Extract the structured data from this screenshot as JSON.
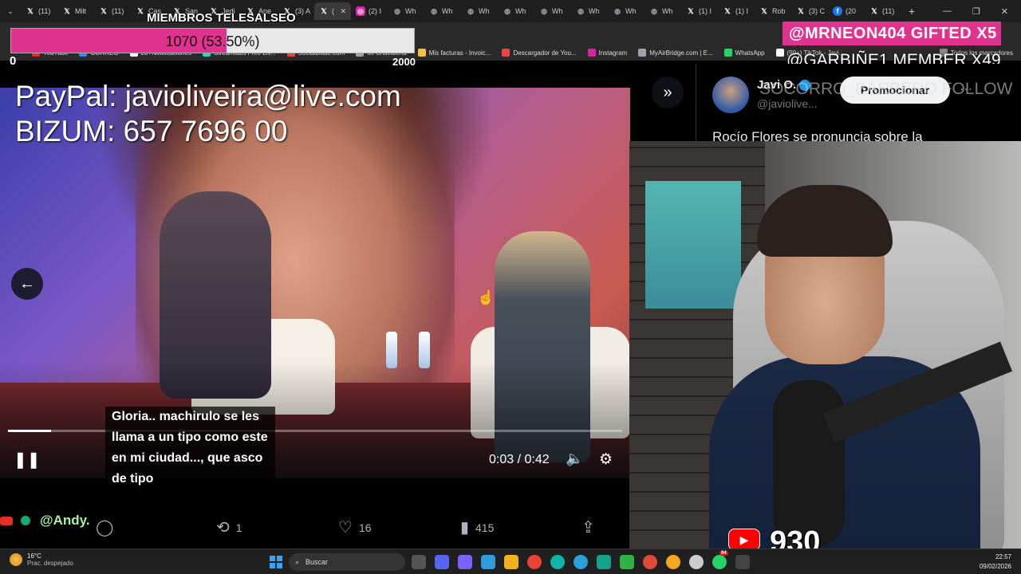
{
  "browser": {
    "tabs": [
      {
        "icon": "x-icon",
        "label": "(11)"
      },
      {
        "icon": "x-icon",
        "label": "Milt"
      },
      {
        "icon": "x-icon",
        "label": "(11)"
      },
      {
        "icon": "x-icon",
        "label": "Cas"
      },
      {
        "icon": "x-icon",
        "label": "San"
      },
      {
        "icon": "x-icon",
        "label": "Jedi"
      },
      {
        "icon": "x-icon",
        "label": "Ane"
      },
      {
        "icon": "x-icon",
        "label": "(3) A"
      },
      {
        "icon": "x-icon",
        "label": "(",
        "active": true
      },
      {
        "icon": "instagram-icon",
        "label": "(2) I"
      },
      {
        "icon": "globe-icon",
        "label": "Wh"
      },
      {
        "icon": "globe-icon",
        "label": "Wh"
      },
      {
        "icon": "globe-icon",
        "label": "Wh"
      },
      {
        "icon": "globe-icon",
        "label": "Wh"
      },
      {
        "icon": "globe-icon",
        "label": "Wh"
      },
      {
        "icon": "globe-icon",
        "label": "Wh"
      },
      {
        "icon": "globe-icon",
        "label": "Wh"
      },
      {
        "icon": "globe-icon",
        "label": "Wh"
      },
      {
        "icon": "x-icon",
        "label": "(1) I"
      },
      {
        "icon": "x-icon",
        "label": "(1) I"
      },
      {
        "icon": "x-icon",
        "label": "Rob"
      },
      {
        "icon": "x-icon",
        "label": "(3) C"
      },
      {
        "icon": "facebook-icon",
        "label": "(20"
      },
      {
        "icon": "x-icon",
        "label": "(11)"
      }
    ],
    "bookmarks": [
      "YouTube",
      "CORREO",
      "20+Notificaciones",
      "Streamlabs Free Liv...",
      "Socialblade.com",
      "Mi Chavalería",
      "Mis facturas - Invoic...",
      "Descargador de You...",
      "Instagram",
      "MyAirBridge.com | E...",
      "WhatsApp",
      "(99+) TikTok - Javi...",
      "Todos los marcadores"
    ]
  },
  "goal": {
    "title": "MIEMBROS TELESALSEO",
    "text": "1070 (53.50%)",
    "progress_percent": 53.5,
    "min": "0",
    "max": "2000"
  },
  "alerts": {
    "gifted": "@MRNEON404  GIFTED X5",
    "member": "@GARBIÑE1  MEMBER X49",
    "follow": "SOCORRO_BARBERO  FOLLOW"
  },
  "donations": {
    "paypal": "PayPal: javiolive​ira@live.com",
    "bizum": "BIZUM: 657 7696 00"
  },
  "player": {
    "timecode": "0:03 / 0:42",
    "progress_percent": 7
  },
  "chat": {
    "message": "Gloria.. machirulo se les llama a un tipo como este en mi ciudad..., que asco de tipo",
    "username": "@Andy."
  },
  "tweet": {
    "name": "Javi O.",
    "handle": "@javiolive...",
    "promote_label": "Promocionar",
    "text": "Rocío Flores se pronuncia sobre la",
    "retweets": "1",
    "likes": "16",
    "views": "415"
  },
  "youtube": {
    "count": "930"
  },
  "taskbar": {
    "temperature": "16°C",
    "weather": "Prac. despejado",
    "search_placeholder": "Buscar",
    "time": "22:57",
    "date": "09/02/2026",
    "whatsapp_badge": "94"
  },
  "colors": {
    "accent_pink": "#e0338f",
    "twitter_blue": "#1d9bf0",
    "youtube_red": "#ff0000"
  }
}
